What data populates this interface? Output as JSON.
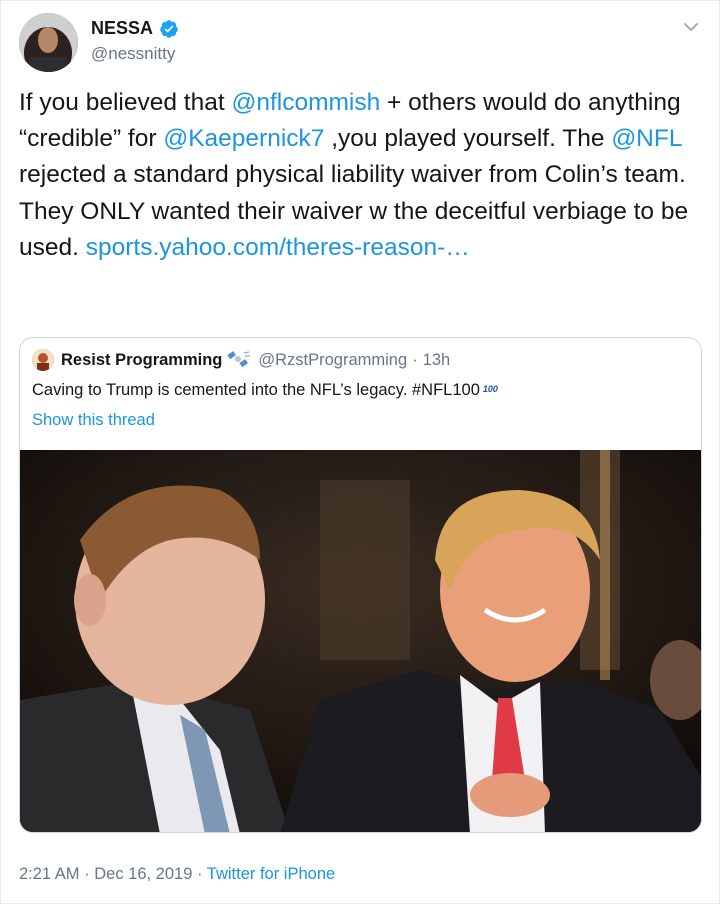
{
  "author": {
    "name": "NESSA",
    "handle": "@nessnitty"
  },
  "tweet": {
    "segments": [
      {
        "text": "If you believed that ",
        "type": "text"
      },
      {
        "text": "@nflcommish",
        "type": "mention"
      },
      {
        "text": " + others would do anything “credible” for ",
        "type": "text"
      },
      {
        "text": "@Kaepernick7",
        "type": "mention"
      },
      {
        "text": " ,you played yourself. The ",
        "type": "text"
      },
      {
        "text": "@NFL",
        "type": "mention"
      },
      {
        "text": " rejected a standard physical liability waiver from Colin’s team. They ONLY wanted their waiver w the deceitful verbiage to be used. ",
        "type": "text"
      },
      {
        "text": "sports.yahoo.com/theres-reason-…",
        "type": "link"
      }
    ]
  },
  "quoted_tweet": {
    "name": "Resist Programming",
    "handle": "@RzstProgramming",
    "separator": "·",
    "time": "13h",
    "text": "Caving to Trump is cemented into the NFL’s legacy. #NFL100",
    "hashtag_badge": "100",
    "show_thread": "Show this thread"
  },
  "meta": {
    "time": "2:21 AM",
    "separator1": "·",
    "date": "Dec 16, 2019",
    "separator2": "·",
    "source": "Twitter for iPhone"
  },
  "colors": {
    "link": "#1b95e0",
    "secondary": "#657786",
    "verified": "#1da1f2"
  },
  "icons": [
    "verified-badge-icon",
    "chevron-down-icon",
    "satellite-emoji-icon"
  ]
}
